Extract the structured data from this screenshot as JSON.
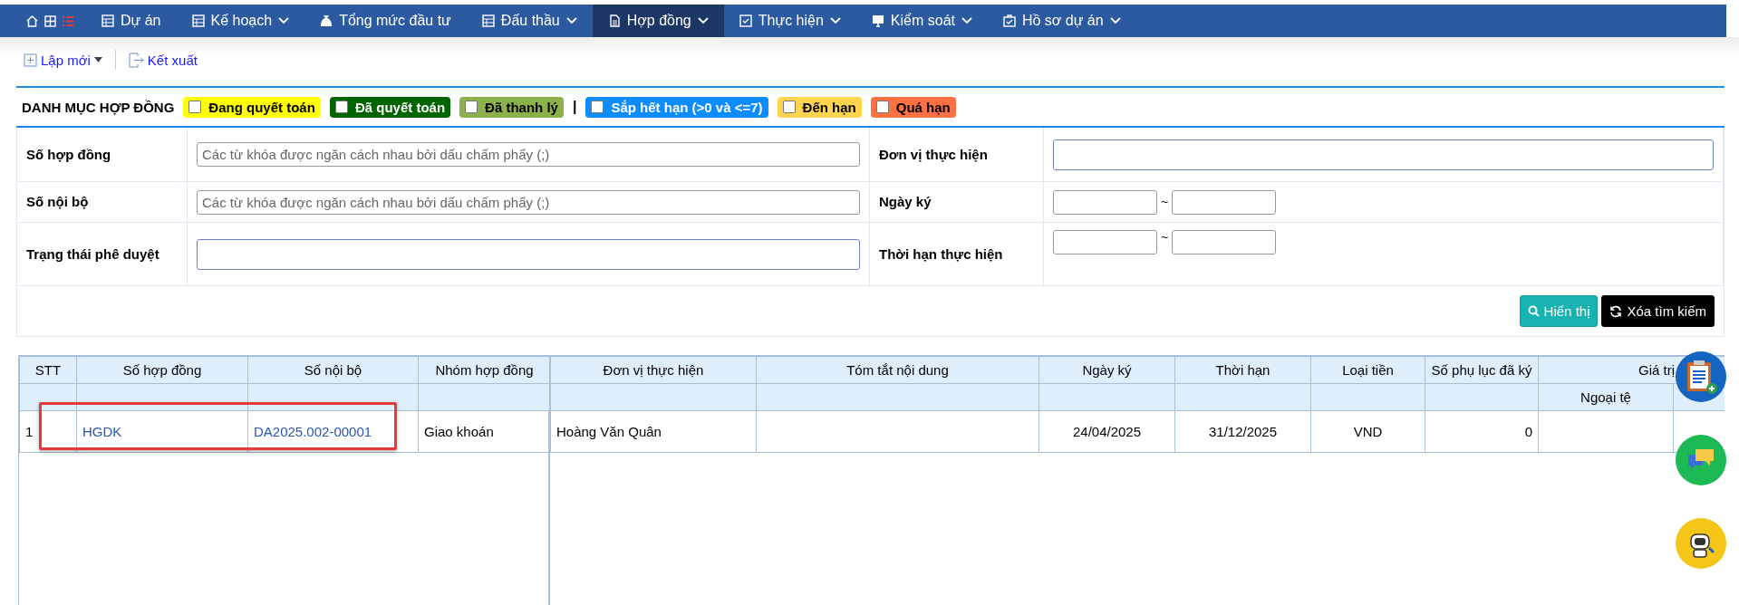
{
  "nav": {
    "items": [
      {
        "label": "Dự án",
        "dropdown": false,
        "selected": false
      },
      {
        "label": "Kế hoạch",
        "dropdown": true,
        "selected": false
      },
      {
        "label": "Tổng mức đầu tư",
        "dropdown": false,
        "selected": false
      },
      {
        "label": "Đấu thầu",
        "dropdown": true,
        "selected": false
      },
      {
        "label": "Hợp đồng",
        "dropdown": true,
        "selected": true
      },
      {
        "label": "Thực hiện",
        "dropdown": true,
        "selected": false
      },
      {
        "label": "Kiểm soát",
        "dropdown": true,
        "selected": false
      },
      {
        "label": "Hồ sơ dự án",
        "dropdown": true,
        "selected": false
      }
    ]
  },
  "toolbar": [
    {
      "label": "Lập mới",
      "dropdown": true
    },
    {
      "label": "Kết xuất",
      "dropdown": false
    }
  ],
  "legend": {
    "title": "DANH MỤC HỢP ĐỒNG",
    "items": [
      {
        "kind": "tag",
        "label": "Đang quyết toán",
        "color": "#ffff00",
        "checked": false
      },
      {
        "kind": "tag",
        "label": "Đã quyết toán",
        "color": "#006400",
        "checked": false
      },
      {
        "kind": "tag",
        "label": "Đã thanh lý",
        "color": "#8db14a",
        "checked": false
      },
      {
        "kind": "separator",
        "label": "|"
      },
      {
        "kind": "tag",
        "label": "Sắp hết hạn (>0 và <=7)",
        "color": "#0d8cff",
        "checked": false
      },
      {
        "kind": "tag",
        "label": "Đến hạn",
        "color": "#ffd54f",
        "checked": false
      },
      {
        "kind": "tag",
        "label": "Quá hạn",
        "color": "#ff7043",
        "checked": false
      }
    ]
  },
  "filters": [
    {
      "left": {
        "label": "Số hợp đồng",
        "kind": "text",
        "placeholder": "Các từ khóa được ngăn cách nhau bởi dấu chấm phẩy (;)"
      },
      "right": {
        "label": "Đơn vị thực hiện",
        "kind": "select"
      }
    },
    {
      "left": {
        "label": "Số nội bộ",
        "kind": "text",
        "placeholder": "Các từ khóa được ngăn cách nhau bởi dấu chấm phẩy (;)"
      },
      "right": {
        "label": "Ngày ký",
        "kind": "range",
        "separator": "~"
      }
    },
    {
      "left": {
        "label": "Trạng thái phê duyệt",
        "kind": "select"
      },
      "right": {
        "label": "Thời hạn thực hiện",
        "kind": "range",
        "separator": "~"
      }
    }
  ],
  "buttons": [
    {
      "label": "Hiển thị",
      "kind": "primary"
    },
    {
      "label": "Xóa tìm kiếm",
      "kind": "dark"
    }
  ],
  "table": {
    "frozen_columns": [
      "STT",
      "Số hợp đồng",
      "Số nội bộ",
      "Nhóm hợp đồng"
    ],
    "columns": [
      "Đơn vị thực hiện",
      "Tóm tắt nội dung",
      "Ngày ký",
      "Thời hạn",
      "Loại tiền",
      "Số phụ lục đã ký",
      "Giá trị"
    ],
    "subheader": "Ngoại tệ",
    "rows": [
      {
        "stt": "1",
        "so_hop_dong": "HGDK",
        "so_noi_bo": "DA2025.002-00001",
        "nhom": "Giao khoán",
        "don_vi": "Hoàng Văn Quân",
        "ngay_ky": "24/04/2025",
        "thoi_han": "31/12/2025",
        "loai_tien": "VND",
        "so_phu_luc": "0",
        "highlighted": true
      }
    ]
  }
}
